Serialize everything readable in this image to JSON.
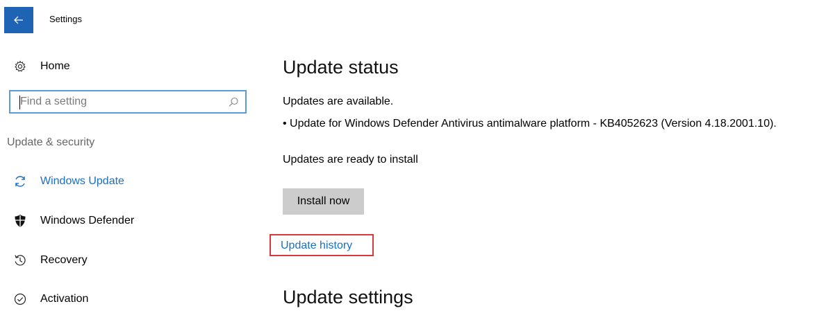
{
  "window": {
    "title": "Settings",
    "back_icon": "back-arrow-icon",
    "accent_color": "#1e63b4"
  },
  "sidebar": {
    "home": {
      "label": "Home",
      "icon": "gear-icon"
    },
    "search": {
      "placeholder": "Find a setting",
      "value": "",
      "icon": "search-icon"
    },
    "section_label": "Update & security",
    "items": [
      {
        "label": "Windows Update",
        "icon": "refresh-icon",
        "selected": true
      },
      {
        "label": "Windows Defender",
        "icon": "shield-icon",
        "selected": false
      },
      {
        "label": "Recovery",
        "icon": "history-icon",
        "selected": false
      },
      {
        "label": "Activation",
        "icon": "check-circle-icon",
        "selected": false
      }
    ],
    "selected_color": "#1a6fc4"
  },
  "main": {
    "update_status_heading": "Update status",
    "available_text": "Updates are available.",
    "update_item": "• Update for Windows Defender Antivirus antimalware platform - KB4052623 (Version 4.18.2001.10).",
    "ready_text": "Updates are ready to install",
    "install_button": "Install now",
    "history_link": "Update history",
    "update_settings_heading": "Update settings",
    "highlight_color": "#d9383a"
  }
}
